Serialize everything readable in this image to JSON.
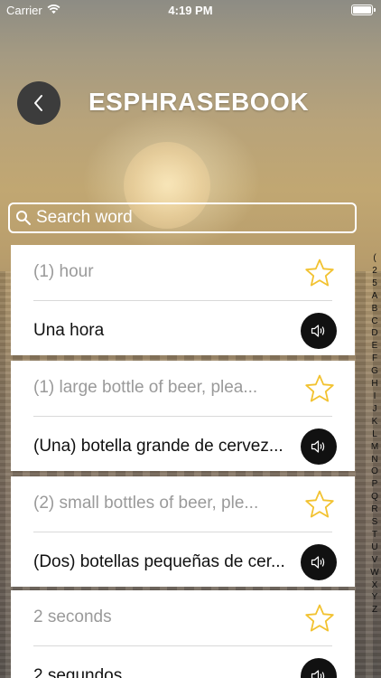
{
  "status_bar": {
    "carrier": "Carrier",
    "time": "4:19 PM"
  },
  "header": {
    "title": "ESPHRASEBOOK",
    "back_icon": "chevron-left-icon"
  },
  "search": {
    "placeholder": "Search word",
    "value": ""
  },
  "phrases": [
    {
      "english": "(1) hour",
      "spanish": "Una hora"
    },
    {
      "english": "(1) large bottle of beer, plea...",
      "spanish": "(Una) botella grande de cervez..."
    },
    {
      "english": "(2) small bottles of beer, ple...",
      "spanish": "(Dos) botellas pequeñas de cer..."
    },
    {
      "english": "2 seconds",
      "spanish": "2 segundos"
    }
  ],
  "index_letters": [
    "(",
    "2",
    "5",
    "A",
    "B",
    "C",
    "D",
    "E",
    "F",
    "G",
    "H",
    "I",
    "J",
    "K",
    "L",
    "M",
    "N",
    "O",
    "P",
    "Q",
    "R",
    "S",
    "T",
    "U",
    "V",
    "W",
    "X",
    "Y",
    "Z"
  ],
  "colors": {
    "star": "#f2c230",
    "sound_button": "#111111",
    "back_button": "#3c3c3c"
  }
}
